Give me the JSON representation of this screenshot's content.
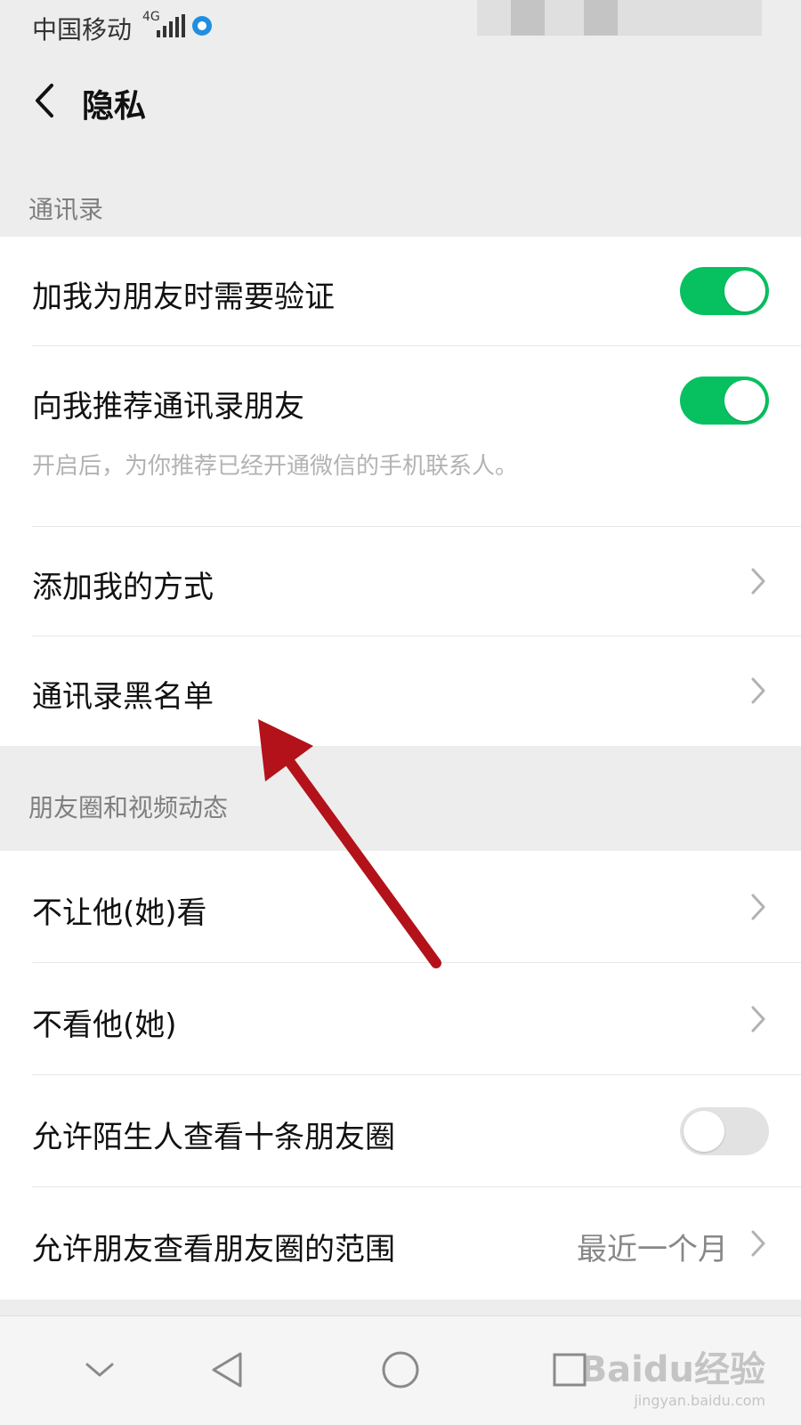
{
  "status_bar": {
    "carrier": "中国移动",
    "network": "4G"
  },
  "header": {
    "title": "隐私"
  },
  "contacts_section": {
    "header": "通讯录",
    "items": [
      {
        "label": "加我为朋友时需要验证",
        "toggle": "on"
      },
      {
        "label": "向我推荐通讯录朋友",
        "toggle": "on",
        "subtitle": "开启后，为你推荐已经开通微信的手机联系人。"
      },
      {
        "label": "添加我的方式"
      },
      {
        "label": "通讯录黑名单"
      }
    ]
  },
  "moments_section": {
    "header": "朋友圈和视频动态",
    "items": [
      {
        "label": "不让他(她)看"
      },
      {
        "label": "不看他(她)"
      },
      {
        "label": "允许陌生人查看十条朋友圈",
        "toggle": "off"
      },
      {
        "label": "允许朋友查看朋友圈的范围",
        "value": "最近一个月"
      }
    ]
  },
  "watermark": {
    "logo": "Baidu经验",
    "url": "jingyan.baidu.com"
  },
  "colors": {
    "toggle_on": "#07c160",
    "toggle_off": "#e2e2e2",
    "background": "#ededed",
    "arrow": "#b3121a"
  }
}
